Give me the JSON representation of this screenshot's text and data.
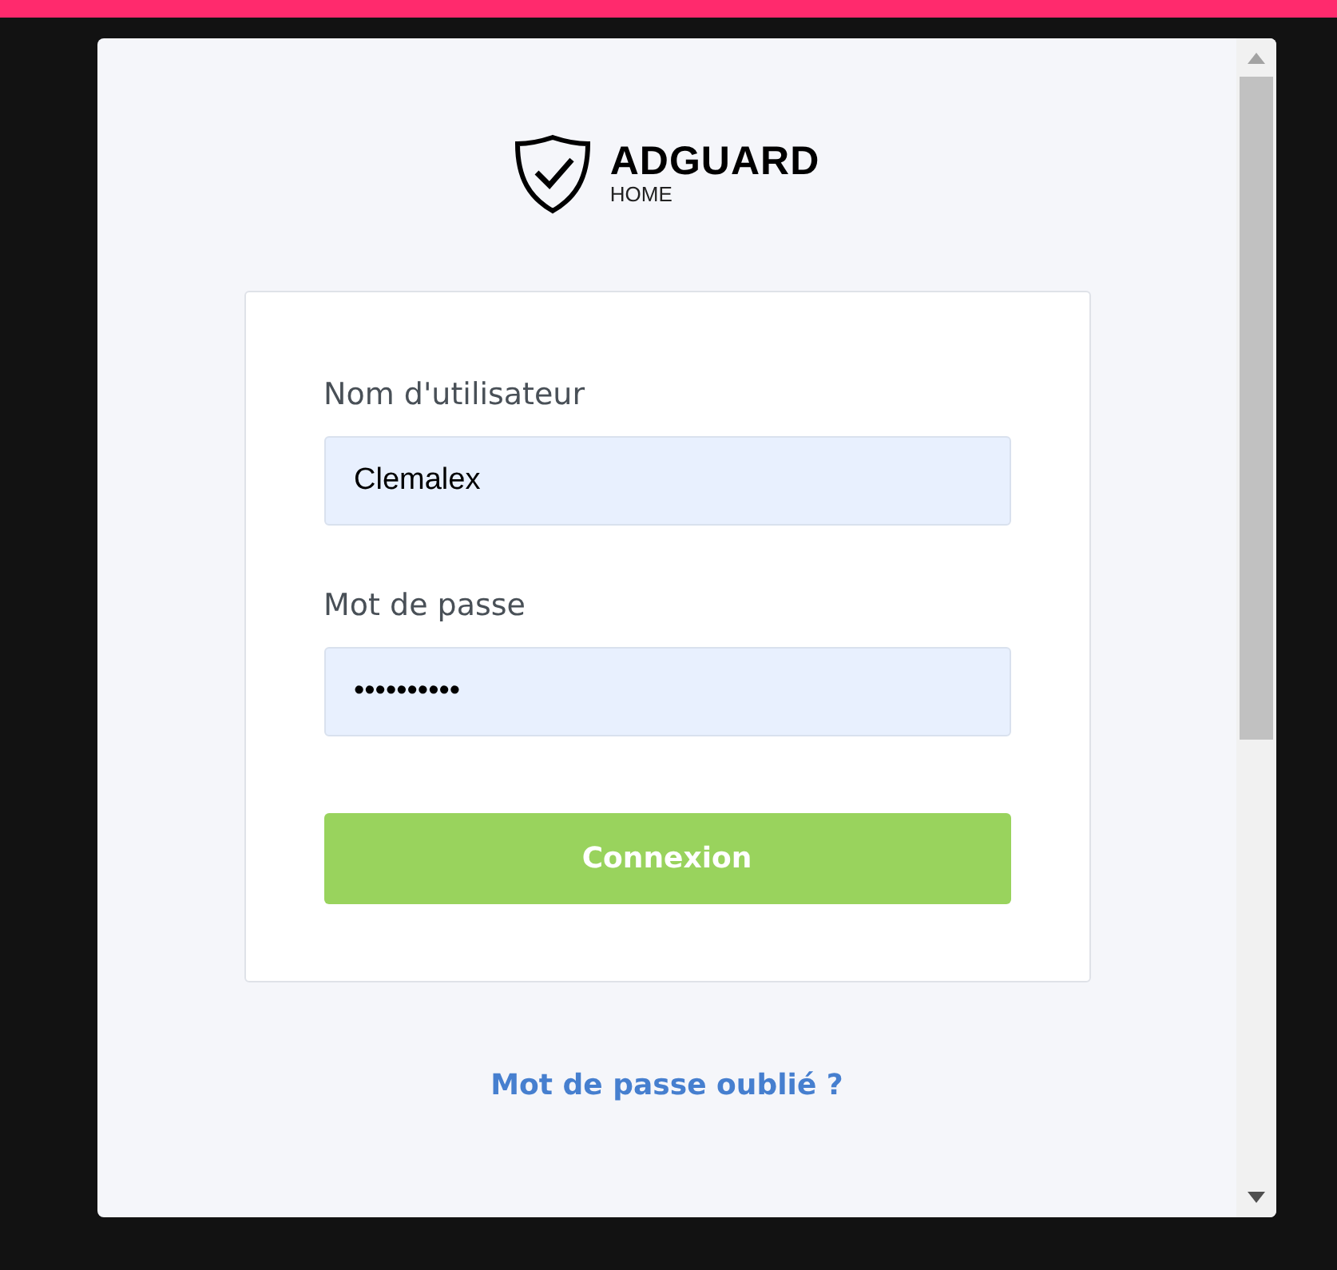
{
  "logo": {
    "title": "ADGUARD",
    "subtitle": "HOME"
  },
  "form": {
    "fields": [
      {
        "label": "Nom d'utilisateur",
        "value": "Clemalex"
      },
      {
        "label": "Mot de passe",
        "value": "••••••••••"
      }
    ],
    "submit": "Connexion"
  },
  "forgot_link": "Mot de passe oublié ?"
}
